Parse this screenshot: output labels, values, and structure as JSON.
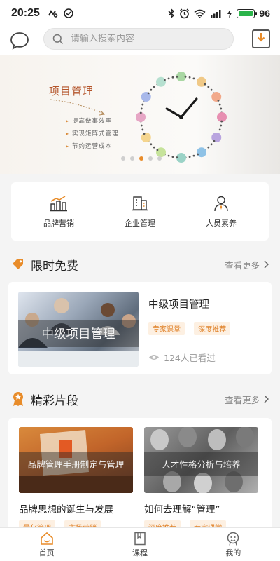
{
  "status_bar": {
    "time": "20:25",
    "battery": "96",
    "battery_level": 0.96
  },
  "search": {
    "placeholder": "请输入搜索内容"
  },
  "banner": {
    "title": "项目管理",
    "bullets": [
      "提高做事效率",
      "实现矩阵式管理",
      "节约运营成本"
    ],
    "page_count": 5,
    "active_page": 3
  },
  "categories": [
    {
      "label": "品牌营销",
      "icon": "bar-chart-icon"
    },
    {
      "label": "企业管理",
      "icon": "building-icon"
    },
    {
      "label": "人员素养",
      "icon": "person-icon"
    }
  ],
  "limited_free": {
    "title": "限时免费",
    "more": "查看更多",
    "course": {
      "thumb_text": "中级项目管理",
      "title": "中级项目管理",
      "tags": [
        "专家课堂",
        "深度推荐"
      ],
      "views": "124人已看过"
    }
  },
  "highlights": {
    "title": "精彩片段",
    "more": "查看更多",
    "items": [
      {
        "thumb_text": "品牌管理手册制定与管理",
        "title": "品牌思想的诞生与发展",
        "tags": [
          "量化管理",
          "市场营销"
        ]
      },
      {
        "thumb_text": "人才性格分析与培养",
        "title": "如何去理解“管理”",
        "tags": [
          "深度推荐",
          "专家课堂"
        ]
      }
    ]
  },
  "tabbar": [
    {
      "label": "首页",
      "icon": "home-icon"
    },
    {
      "label": "课程",
      "icon": "book-icon"
    },
    {
      "label": "我的",
      "icon": "profile-icon"
    }
  ],
  "colors": {
    "accent": "#e88c2a",
    "banner_title": "#b4542a",
    "tag_text": "#e0822a",
    "tag_bg": "#fdf0e2"
  }
}
